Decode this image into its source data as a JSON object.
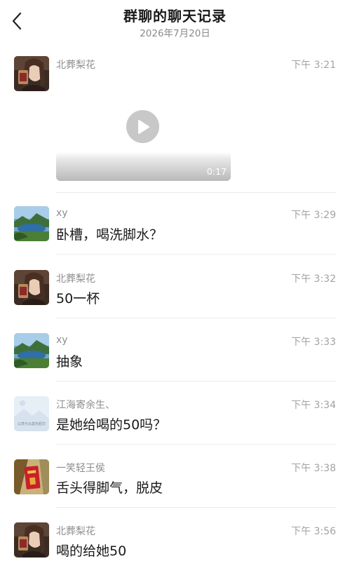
{
  "header": {
    "title": "群聊的聊天记录",
    "date": "2026年7月20日"
  },
  "messages": [
    {
      "sender": "北葬梨花",
      "time": "下午 3:21",
      "type": "video",
      "duration": "0:17",
      "avatar": "portrait-girl"
    },
    {
      "sender": "xy",
      "time": "下午 3:29",
      "type": "text",
      "text": "卧槽，喝洗脚水？",
      "avatar": "lake-landscape"
    },
    {
      "sender": "北葬梨花",
      "time": "下午 3:32",
      "type": "text",
      "text": "50一杯",
      "avatar": "portrait-girl"
    },
    {
      "sender": "xy",
      "time": "下午 3:33",
      "type": "text",
      "text": "抽象",
      "avatar": "lake-landscape"
    },
    {
      "sender": "江海寄余生、",
      "time": "下午 3:34",
      "type": "text",
      "text": "是她给喝的50吗？",
      "avatar": "pale-sky-text",
      "avatar_caption": "以梦为马莫负韶华"
    },
    {
      "sender": "一笑轻王侯",
      "time": "下午 3:38",
      "type": "text",
      "text": "舌头得脚气，脱皮",
      "avatar": "red-envelope"
    },
    {
      "sender": "北葬梨花",
      "time": "下午 3:56",
      "type": "text",
      "text": "喝的给她50",
      "avatar": "portrait-girl"
    }
  ],
  "icons": {
    "back": "chevron-left-icon",
    "play": "play-icon"
  }
}
